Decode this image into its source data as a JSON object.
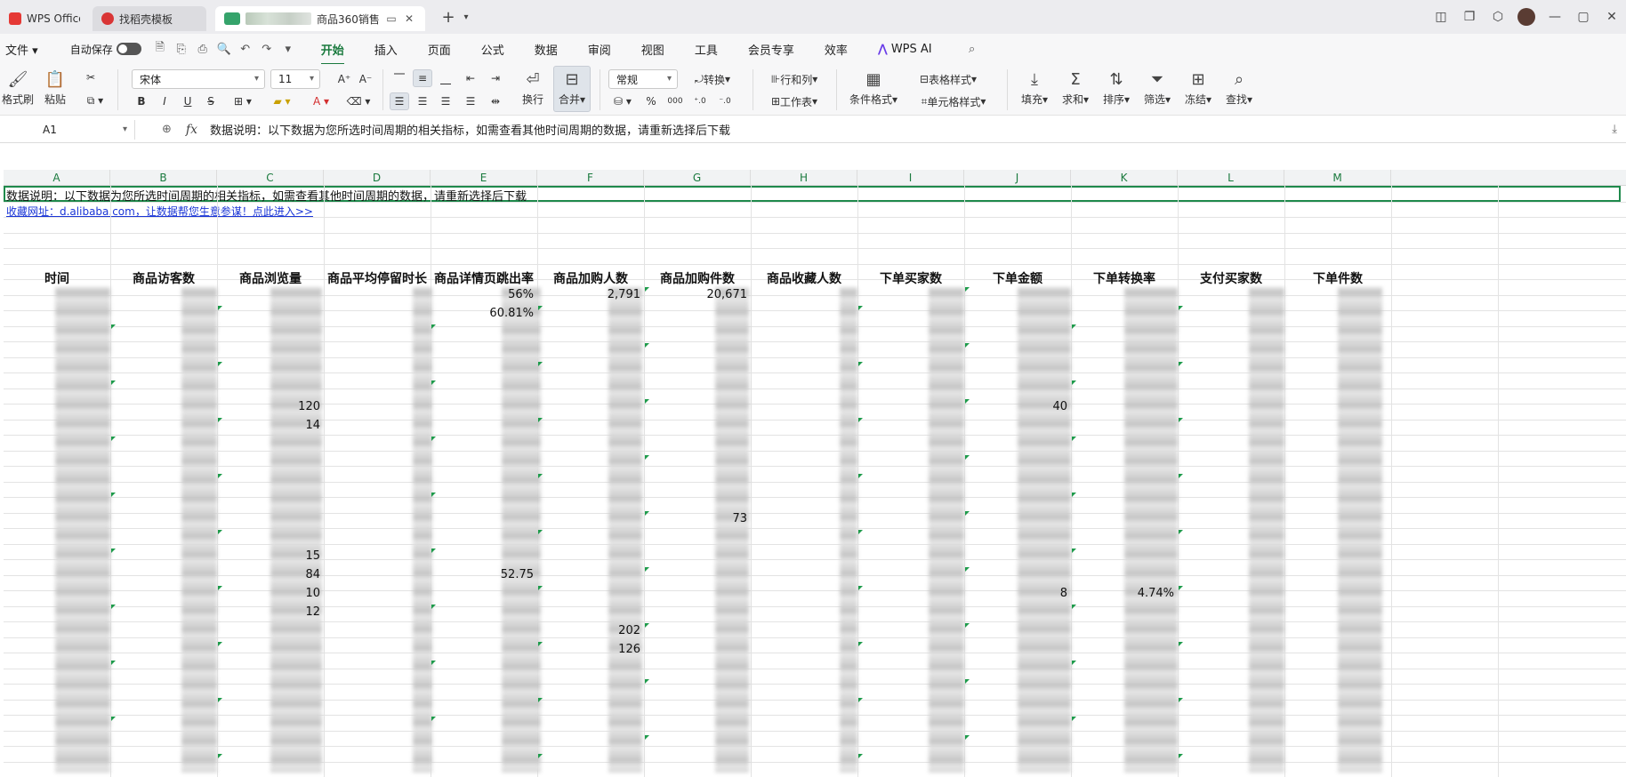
{
  "tabs": {
    "home_tab": "WPS Office",
    "template_tab": "找稻壳模板",
    "file_tab": "商品360销售"
  },
  "menu": {
    "file": "文件",
    "autosave": "自动保存",
    "items": [
      "开始",
      "插入",
      "页面",
      "公式",
      "数据",
      "审阅",
      "视图",
      "工具",
      "会员专享",
      "效率"
    ],
    "active": "开始",
    "wps_ai": "WPS AI"
  },
  "ribbon": {
    "format_painter": "格式刷",
    "paste": "粘贴",
    "font_name": "宋体",
    "font_size": "11",
    "wrap": "换行",
    "merge": "合并",
    "number_format": "常规",
    "convert": "转换",
    "row_col": "行和列",
    "worksheet": "工作表",
    "conditional_format": "条件格式",
    "table_style": "表格样式",
    "cell_style": "单元格样式",
    "fill": "填充",
    "sum": "求和",
    "sort": "排序",
    "filter": "筛选",
    "freeze": "冻结",
    "find": "查找",
    "font_btns": [
      "B",
      "I",
      "U"
    ],
    "pct": "%"
  },
  "formula_bar": {
    "cell_ref": "A1",
    "content": "数据说明：以下数据为您所选时间周期的相关指标，如需查看其他时间周期的数据，请重新选择后下载"
  },
  "sheet": {
    "columns": [
      "A",
      "B",
      "C",
      "D",
      "E",
      "F",
      "G",
      "H",
      "I",
      "J",
      "K",
      "L",
      "M"
    ],
    "note": "数据说明：以下数据为您所选时间周期的相关指标，如需查看其他时间周期的数据，请重新选择后下载",
    "source_link": "收藏网址：d.alibaba.com，让数据帮您生意参谋！点此进入>>",
    "headers": [
      "时间",
      "商品访客数",
      "商品浏览量",
      "商品平均停留时长",
      "商品详情页跳出率",
      "商品加购人数",
      "商品加购件数",
      "商品收藏人数",
      "下单买家数",
      "下单金额",
      "下单转换率",
      "支付买家数",
      "下单件数"
    ],
    "visible_values": {
      "e1": "56%",
      "e2": "60.81%",
      "f1": "2,791",
      "g1": "20,671",
      "c7": "120",
      "c8": "14",
      "g13": "73",
      "c15": "15",
      "c16": "84",
      "e16": "52.75",
      "c17": "10",
      "c18": "12",
      "f19": "202",
      "f20": "126",
      "k17": "4.74%",
      "j7": "40",
      "j17": "8"
    }
  },
  "colors": {
    "accent": "#1a7a3e",
    "selection": "#1f8a4c",
    "link": "#1a35d6"
  }
}
